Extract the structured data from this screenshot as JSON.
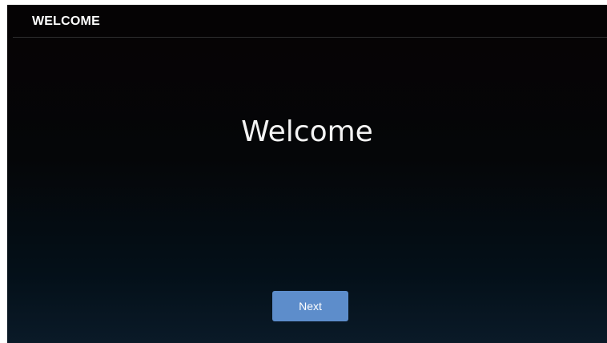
{
  "header": {
    "title": "WELCOME"
  },
  "main": {
    "welcome_text": "Welcome"
  },
  "footer": {
    "next_label": "Next"
  },
  "colors": {
    "background": "#050608",
    "header_background": "#050304",
    "button": "#5d8dcb",
    "text": "#ffffff"
  }
}
